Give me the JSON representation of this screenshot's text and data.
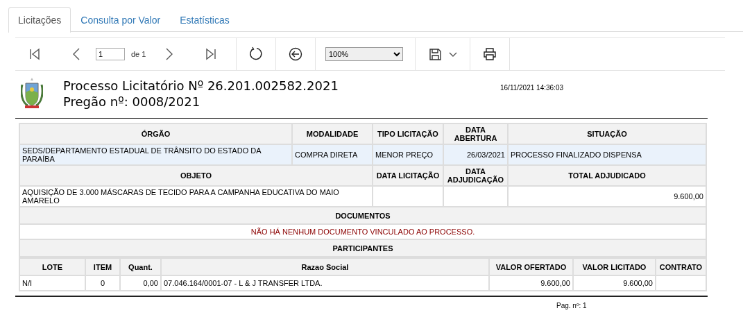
{
  "tabs": [
    {
      "label": "Licitações",
      "selected": true
    },
    {
      "label": "Consulta por Valor",
      "selected": false
    },
    {
      "label": "Estatísticas",
      "selected": false
    }
  ],
  "toolbar": {
    "page": "1",
    "page_count": "de 1",
    "zoom": "100%"
  },
  "report": {
    "title": "Processo Licitatório Nº 26.201.002582.2021",
    "subtitle": "Pregão nº: 0008/2021",
    "timestamp": "16/11/2021 14:36:03",
    "summary": {
      "columns": [
        "ÓRGÃO",
        "MODALIDADE",
        "TIPO LICITAÇÃO",
        "DATA ABERTURA",
        "SITUAÇÃO"
      ],
      "row": [
        "SEDS/DEPARTAMENTO ESTADUAL DE TRÂNSITO DO ESTADO DA PARAÍBA",
        "COMPRA DIRETA",
        "MENOR PREÇO",
        "26/03/2021",
        "PROCESSO FINALIZADO DISPENSA"
      ]
    },
    "details": {
      "columns": [
        "OBJETO",
        "DATA LICITAÇÃO",
        "DATA ADJUDICAÇÃO",
        "TOTAL ADJUDICADO"
      ],
      "objeto": "AQUISIÇÃO DE 3.000 MÁSCARAS DE TECIDO PARA A CAMPANHA EDUCATIVA DO MAIO AMARELO",
      "total": "9.600,00"
    },
    "documents": {
      "heading": "DOCUMENTOS",
      "message": "NÃO HÁ NENHUM DOCUMENTO VINCULADO AO PROCESSO."
    },
    "participants": {
      "heading": "PARTICIPANTES",
      "columns": [
        "LOTE",
        "ITEM",
        "Quant.",
        "Razao Social",
        "VALOR OFERTADO",
        "VALOR LICITADO",
        "CONTRATO"
      ],
      "rows": [
        {
          "lote": "N/I",
          "item": "0",
          "quant": "0,00",
          "razao_social": "07.046.164/0001-07 - L & J TRANSFER LTDA.",
          "valor_ofertado": "9.600,00",
          "valor_licitado": "9.600,00"
        }
      ]
    },
    "footer": "Pag. nº: 1"
  }
}
